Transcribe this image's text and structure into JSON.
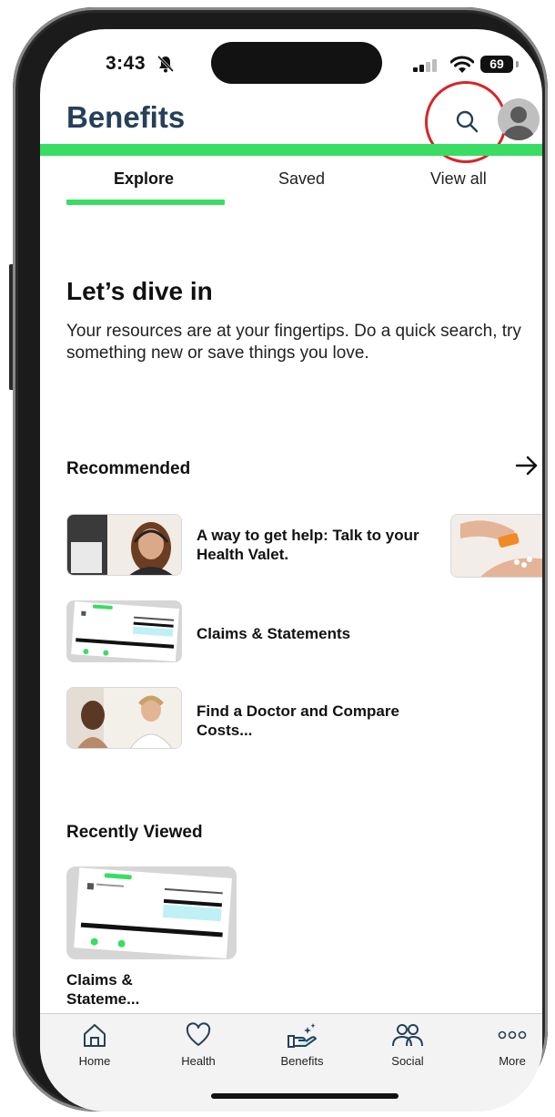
{
  "status_bar": {
    "time": "3:43",
    "battery": "69"
  },
  "header": {
    "title": "Benefits"
  },
  "tabs": [
    {
      "label": "Explore",
      "active": true
    },
    {
      "label": "Saved",
      "active": false
    },
    {
      "label": "View all",
      "active": false
    }
  ],
  "hero": {
    "title": "Let’s dive in",
    "description": "Your resources are at your fingertips. Do a quick search, try something new or save things you love."
  },
  "recommended": {
    "title": "Recommended",
    "items": [
      {
        "label": "A way to get help: Talk to your Health Valet."
      },
      {
        "label": "Claims & Statements"
      },
      {
        "label": "Find a Doctor and Compare Costs..."
      }
    ]
  },
  "recently_viewed": {
    "title": "Recently Viewed",
    "items": [
      {
        "label": "Claims & Stateme..."
      }
    ]
  },
  "nav": [
    {
      "label": "Home",
      "icon": "home-icon"
    },
    {
      "label": "Health",
      "icon": "heart-icon"
    },
    {
      "label": "Benefits",
      "icon": "hand-sparkle-icon"
    },
    {
      "label": "Social",
      "icon": "people-icon"
    },
    {
      "label": "More",
      "icon": "dots-icon"
    }
  ],
  "colors": {
    "accent_green": "#39dd63",
    "title_navy": "#25405a",
    "highlight_red": "#d6262a"
  }
}
